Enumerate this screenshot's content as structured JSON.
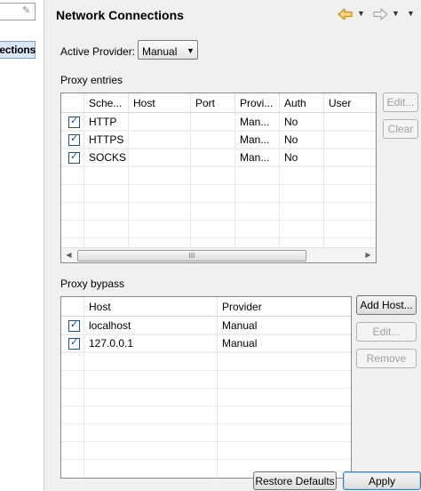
{
  "left_pane": {
    "selected_item": "Connections"
  },
  "header": {
    "title": "Network Connections"
  },
  "active_provider": {
    "label": "Active Provider:",
    "value": "Manual"
  },
  "proxy_entries": {
    "label": "Proxy entries",
    "columns": [
      "Sche...",
      "Host",
      "Port",
      "Provi...",
      "Auth",
      "User"
    ],
    "rows": [
      {
        "checked": true,
        "scheme": "HTTP",
        "host": "",
        "port": "",
        "provider": "Man...",
        "auth": "No",
        "user": ""
      },
      {
        "checked": true,
        "scheme": "HTTPS",
        "host": "",
        "port": "",
        "provider": "Man...",
        "auth": "No",
        "user": ""
      },
      {
        "checked": true,
        "scheme": "SOCKS",
        "host": "",
        "port": "",
        "provider": "Man...",
        "auth": "No",
        "user": ""
      }
    ],
    "edit_label": "Edit...",
    "clear_label": "Clear",
    "scroll_thumb_grip": "III"
  },
  "proxy_bypass": {
    "label": "Proxy bypass",
    "columns": [
      "Host",
      "Provider"
    ],
    "rows": [
      {
        "checked": true,
        "host": "localhost",
        "provider": "Manual"
      },
      {
        "checked": true,
        "host": "127.0.0.1",
        "provider": "Manual"
      }
    ],
    "add_host_label": "Add Host...",
    "edit_label": "Edit...",
    "remove_label": "Remove"
  },
  "footer": {
    "restore_defaults_label": "Restore Defaults",
    "apply_label": "Apply"
  },
  "colors": {
    "nav_arrow": "#e0a326",
    "selection": "#d9e7f7",
    "check_mark": "#21409a"
  }
}
